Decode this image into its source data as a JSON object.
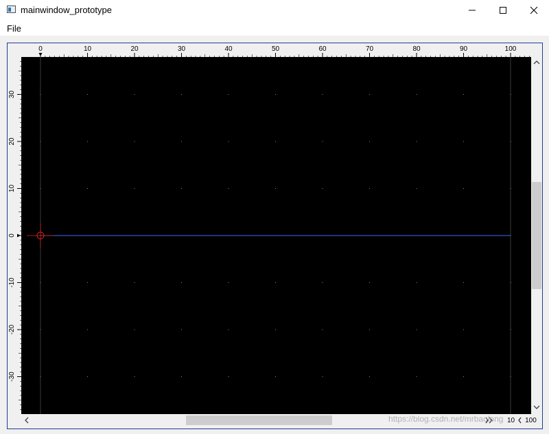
{
  "window": {
    "title": "mainwindow_prototype",
    "icons": {
      "app": "app-window-icon",
      "minimize": "minimize-icon",
      "maximize": "maximize-icon",
      "close": "close-icon"
    }
  },
  "menubar": {
    "items": [
      {
        "label": "File"
      }
    ]
  },
  "rulers": {
    "horizontal_ticks": [
      "0",
      "10",
      "20",
      "30",
      "40",
      "50",
      "60",
      "70",
      "80",
      "90",
      "100"
    ],
    "vertical_ticks": [
      "30",
      "20",
      "10",
      "0",
      "-10",
      "-20",
      "-30"
    ]
  },
  "canvas": {
    "background_color": "#000000",
    "grid_dot_color": "#8a8a8a",
    "axis_line_color": "#4466ff",
    "origin_marker_color": "#cc2222"
  },
  "statusbar": {
    "zoom_left": "10",
    "zoom_right": "100",
    "decrease_icon": "chevron-left-icon",
    "increase_icon": "chevron-right-icon"
  },
  "watermark": "https://blog.csdn.net/mrbaolong"
}
